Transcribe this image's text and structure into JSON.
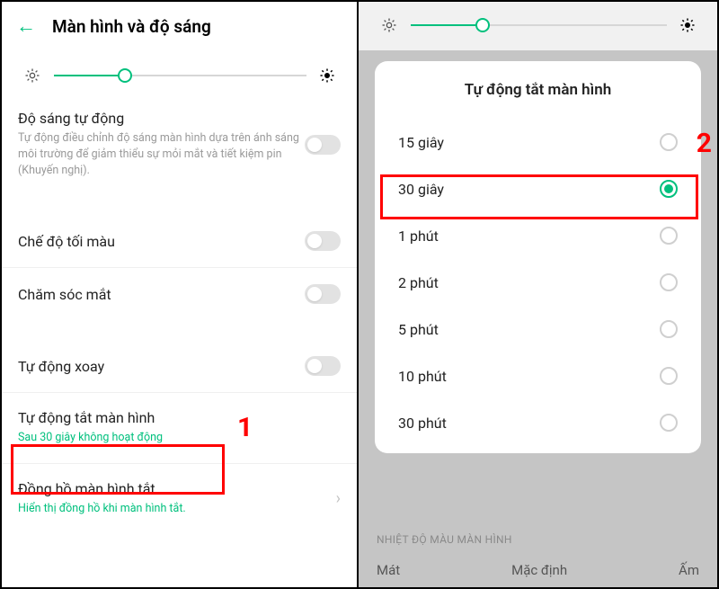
{
  "left": {
    "header_title": "Màn hình và độ sáng",
    "slider_fill_pct": 28,
    "auto_brightness": {
      "title": "Độ sáng tự động",
      "desc": "Tự động điều chỉnh độ sáng màn hình dựa trên ánh sáng môi trường để giảm thiểu sự mỏi mắt và tiết kiệm pin (Khuyến nghị)."
    },
    "dark_mode": {
      "title": "Chế độ tối màu"
    },
    "eye_care": {
      "title": "Chăm sóc mắt"
    },
    "auto_rotate": {
      "title": "Tự động xoay"
    },
    "screen_off": {
      "title": "Tự động tắt màn hình",
      "desc": "Sau 30 giây không hoạt động"
    },
    "always_on": {
      "title": "Đồng hồ màn hình tắt",
      "desc": "Hiển thị đồng hồ khi màn hình tắt."
    }
  },
  "right": {
    "slider_fill_pct": 28,
    "dialog_title": "Tự động tắt màn hình",
    "options": [
      {
        "label": "15 giây",
        "selected": false
      },
      {
        "label": "30 giây",
        "selected": true
      },
      {
        "label": "1 phút",
        "selected": false
      },
      {
        "label": "2 phút",
        "selected": false
      },
      {
        "label": "5 phút",
        "selected": false
      },
      {
        "label": "10 phút",
        "selected": false
      },
      {
        "label": "30 phút",
        "selected": false
      }
    ],
    "temp_label": "NHIỆT ĐỘ MÀU MÀN HÌNH",
    "temp_opts": [
      "Mát",
      "Mặc định",
      "Ấm"
    ]
  },
  "callouts": {
    "one": "1",
    "two": "2"
  }
}
